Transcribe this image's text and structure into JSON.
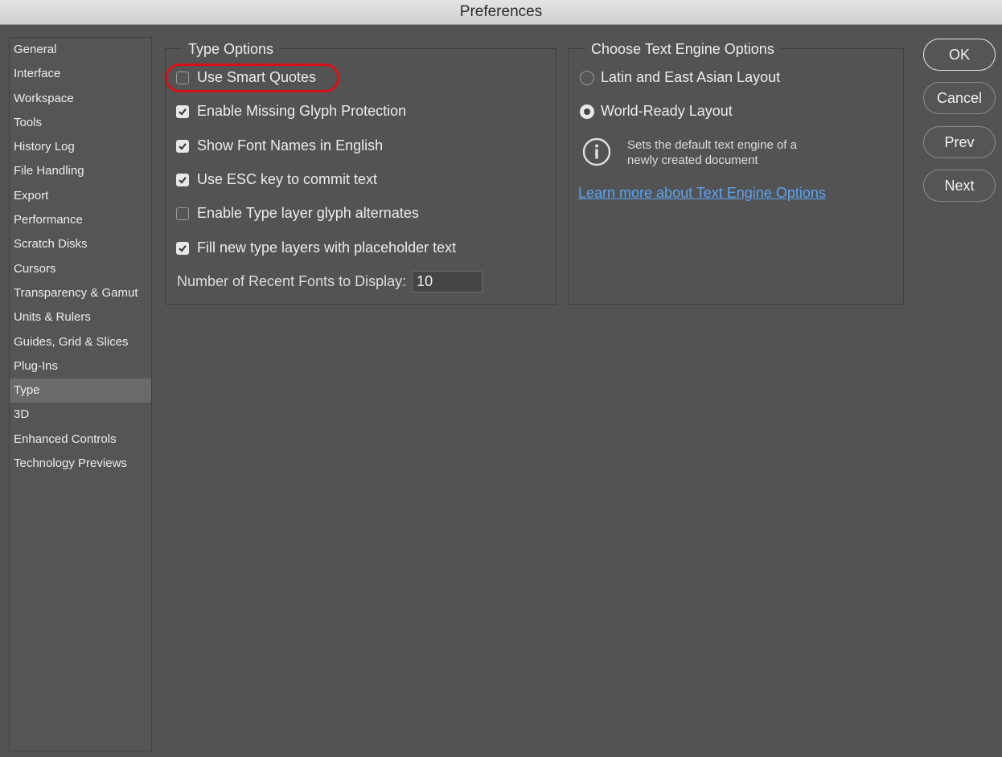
{
  "window": {
    "title": "Preferences"
  },
  "sidebar": {
    "items": [
      {
        "label": "General",
        "active": false
      },
      {
        "label": "Interface",
        "active": false
      },
      {
        "label": "Workspace",
        "active": false
      },
      {
        "label": "Tools",
        "active": false
      },
      {
        "label": "History Log",
        "active": false
      },
      {
        "label": "File Handling",
        "active": false
      },
      {
        "label": "Export",
        "active": false
      },
      {
        "label": "Performance",
        "active": false
      },
      {
        "label": "Scratch Disks",
        "active": false
      },
      {
        "label": "Cursors",
        "active": false
      },
      {
        "label": "Transparency & Gamut",
        "active": false
      },
      {
        "label": "Units & Rulers",
        "active": false
      },
      {
        "label": "Guides, Grid & Slices",
        "active": false
      },
      {
        "label": "Plug-Ins",
        "active": false
      },
      {
        "label": "Type",
        "active": true
      },
      {
        "label": "3D",
        "active": false
      },
      {
        "label": "Enhanced Controls",
        "active": false
      },
      {
        "label": "Technology Previews",
        "active": false
      }
    ]
  },
  "type_options": {
    "title": "Type Options",
    "checkboxes": [
      {
        "label": "Use Smart Quotes",
        "checked": false
      },
      {
        "label": "Enable Missing Glyph Protection",
        "checked": true
      },
      {
        "label": "Show Font Names in English",
        "checked": true
      },
      {
        "label": "Use ESC key to commit text",
        "checked": true
      },
      {
        "label": "Enable Type layer glyph alternates",
        "checked": false
      },
      {
        "label": "Fill new type layers with placeholder text",
        "checked": true
      }
    ],
    "recent_fonts_label": "Number of Recent Fonts to Display:",
    "recent_fonts_value": "10"
  },
  "text_engine": {
    "title": "Choose Text Engine Options",
    "radios": [
      {
        "label": "Latin and East Asian Layout",
        "selected": false
      },
      {
        "label": "World-Ready Layout",
        "selected": true
      }
    ],
    "info_line1": "Sets the default text engine of a",
    "info_line2": "newly created document",
    "link": "Learn more about Text Engine Options"
  },
  "buttons": {
    "ok": "OK",
    "cancel": "Cancel",
    "prev": "Prev",
    "next": "Next"
  },
  "colors": {
    "background": "#535353",
    "highlight": "#d80f14",
    "link": "#5aa4f2"
  }
}
